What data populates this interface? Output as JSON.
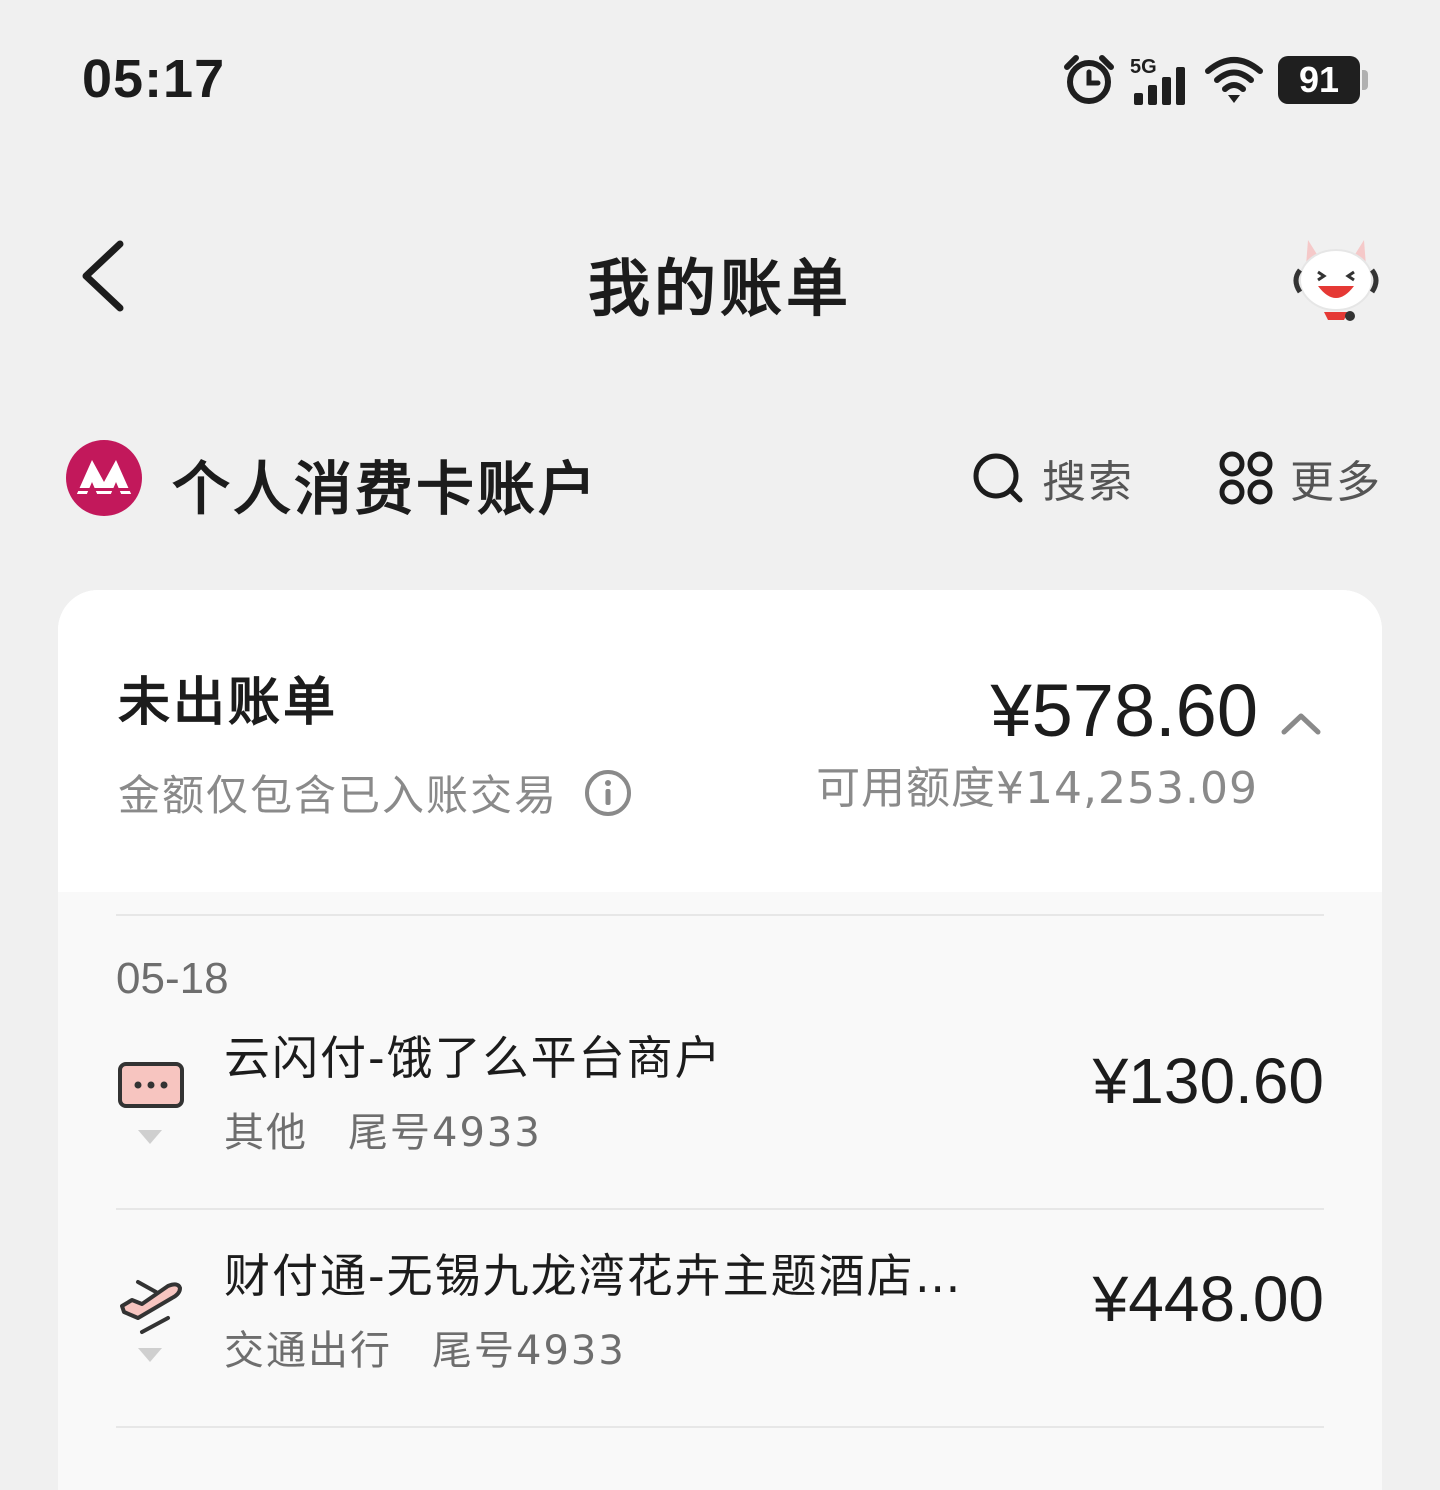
{
  "status_bar": {
    "time": "05:17",
    "network": "5G",
    "battery": "91",
    "icons": [
      "alarm-icon",
      "signal-icon",
      "wifi-icon",
      "battery-icon"
    ]
  },
  "nav": {
    "title": "我的账单",
    "back_icon": "chevron-left-icon",
    "service_icon": "customer-service-mascot-icon"
  },
  "account": {
    "name": "个人消费卡账户",
    "search_label": "搜索",
    "more_label": "更多",
    "brand_color": "#c2185b"
  },
  "unbilled": {
    "title": "未出账单",
    "note": "金额仅包含已入账交易",
    "amount": "¥578.60",
    "credit": "可用额度¥14,253.09"
  },
  "transactions": {
    "date": "05-18",
    "items": [
      {
        "merchant": "云闪付-饿了么平台商户",
        "category": "其他",
        "card": "尾号4933",
        "amount": "¥130.60",
        "icon": "other-category-icon"
      },
      {
        "merchant": "财付通-无锡九龙湾花卉主题酒店…",
        "category": "交通出行",
        "card": "尾号4933",
        "amount": "¥448.00",
        "icon": "airplane-icon"
      }
    ]
  }
}
